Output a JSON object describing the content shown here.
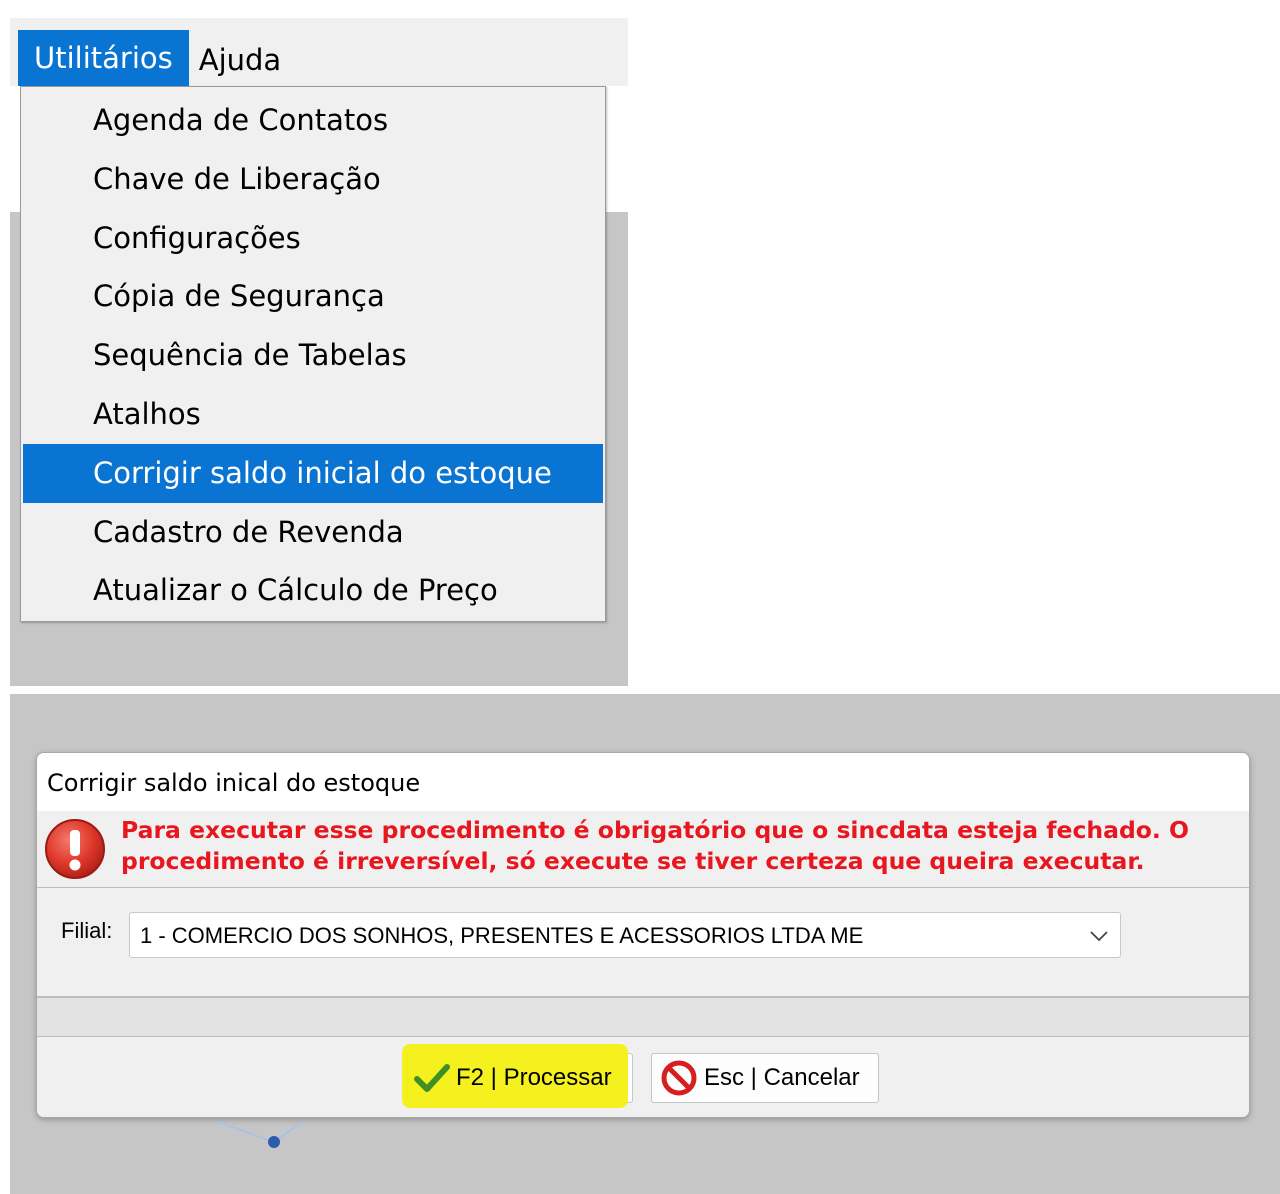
{
  "menubar": {
    "items": [
      {
        "label": "Utilitários",
        "active": true
      },
      {
        "label": "Ajuda",
        "active": false
      }
    ]
  },
  "menu": {
    "items": [
      {
        "label": "Agenda de Contatos"
      },
      {
        "label": "Chave de Liberação"
      },
      {
        "label": "Configurações"
      },
      {
        "label": "Cópia de Segurança"
      },
      {
        "label": "Sequência de Tabelas"
      },
      {
        "label": "Atalhos"
      },
      {
        "label": "Corrigir saldo inicial do estoque",
        "highlighted": true
      },
      {
        "label": "Cadastro de Revenda"
      },
      {
        "label": "Atualizar o Cálculo de Preço"
      }
    ]
  },
  "dialog": {
    "title": "Corrigir saldo inical do estoque",
    "warning_icon": "exclamation-icon",
    "warning": "Para executar esse procedimento é obrigatório que o sincdata esteja fechado. O procedimento é irreversível, só execute se tiver certeza que queira executar.",
    "filial_label": "Filial:",
    "filial_value": "1 - COMERCIO DOS SONHOS, PRESENTES E ACESSORIOS LTDA ME",
    "process_button": "F2 | Processar",
    "process_icon": "checkmark-icon",
    "cancel_button": "Esc | Cancelar",
    "cancel_icon": "no-entry-icon"
  },
  "colors": {
    "accent": "#0a74d3",
    "warning_text": "#e8161f",
    "highlight": "#f3f012",
    "window_bg": "#f0f0f0",
    "backdrop": "#c6c6c6"
  }
}
